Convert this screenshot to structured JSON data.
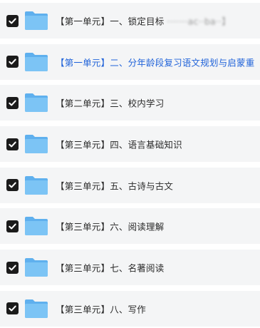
{
  "files": [
    {
      "name": "【第一单元】一、锁定目标",
      "blurred_suffix": "·······ac··ba··】",
      "checked": true,
      "active": false,
      "icon": "folder-icon"
    },
    {
      "name": "【第一单元】二、分年龄段复习语文规划与启蒙重",
      "checked": true,
      "active": true,
      "icon": "folder-icon"
    },
    {
      "name": "【第二单元】三、校内学习",
      "checked": true,
      "active": false,
      "icon": "folder-icon"
    },
    {
      "name": "【第三单元】四、语言基础知识",
      "checked": true,
      "active": false,
      "icon": "folder-icon"
    },
    {
      "name": "【第三单元】五、古诗与古文",
      "checked": true,
      "active": false,
      "icon": "folder-icon"
    },
    {
      "name": "【第三单元】六、阅读理解",
      "checked": true,
      "active": false,
      "icon": "folder-icon"
    },
    {
      "name": "【第三单元】七、名著阅读",
      "checked": true,
      "active": false,
      "icon": "folder-icon"
    },
    {
      "name": "【第三单元】八、写作",
      "checked": true,
      "active": false,
      "icon": "folder-icon"
    }
  ],
  "colors": {
    "row_bg": "#f4f5f6",
    "checkbox_bg": "#1b1b1b",
    "folder_front": "#7cc4f5",
    "folder_back": "#5fb0ee",
    "active_text": "#1f62d9"
  }
}
